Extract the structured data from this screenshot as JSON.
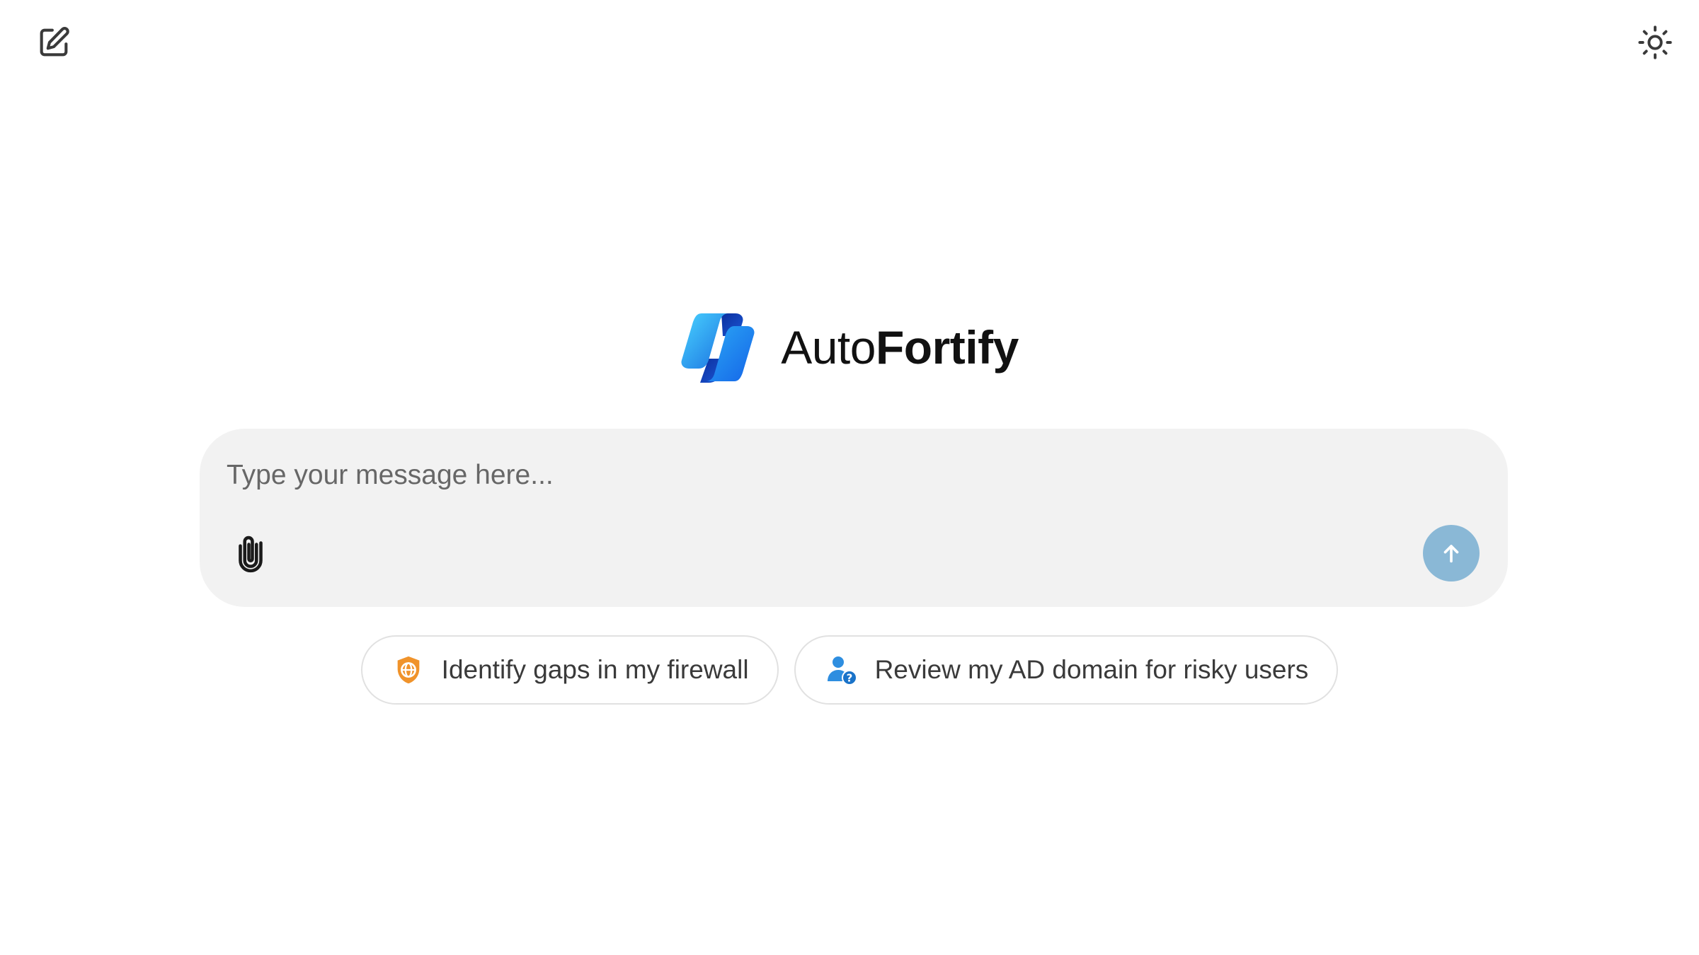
{
  "header": {
    "new_chat_icon": "edit-square-icon",
    "theme_icon": "sun-icon"
  },
  "brand": {
    "name_regular": "Auto",
    "name_bold": "Fortify",
    "logo_icon": "copilot-ribbon-logo"
  },
  "composer": {
    "placeholder": "Type your message here...",
    "value": "",
    "attach_icon": "paperclip-icon",
    "send_icon": "arrow-up-icon"
  },
  "suggestions": [
    {
      "label": "Identify gaps in my firewall",
      "icon": "shield-globe-icon"
    },
    {
      "label": "Review my AD domain for risky users",
      "icon": "user-question-icon"
    }
  ],
  "colors": {
    "background": "#ffffff",
    "composer_bg": "#f2f2f2",
    "send_button": "#8ab8d6",
    "shield_orange": "#f0932b",
    "user_blue": "#2e8ee0",
    "chip_border": "#e1e1e1"
  }
}
